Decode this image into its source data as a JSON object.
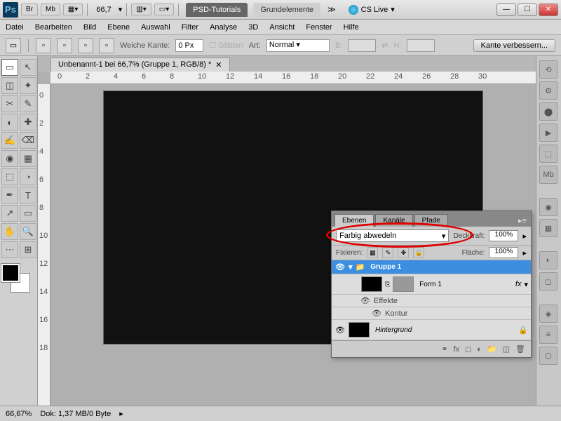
{
  "titlebar": {
    "zoom": "66,7",
    "tab1": "PSD-Tutorials",
    "tab2": "Grundelemente",
    "cslive": "CS Live"
  },
  "menu": [
    "Datei",
    "Bearbeiten",
    "Bild",
    "Ebene",
    "Auswahl",
    "Filter",
    "Analyse",
    "3D",
    "Ansicht",
    "Fenster",
    "Hilfe"
  ],
  "options": {
    "feather_label": "Weiche Kante:",
    "feather_value": "0 Px",
    "antialias": "Glätten",
    "style_label": "Art:",
    "style_value": "Normal",
    "width_label": "B:",
    "height_label": "H:",
    "refine": "Kante verbessern..."
  },
  "document": {
    "tab_title": "Unbenannt-1 bei 66,7% (Gruppe 1, RGB/8) *"
  },
  "ruler_h": [
    "0",
    "2",
    "4",
    "6",
    "8",
    "10",
    "12",
    "14",
    "16",
    "18",
    "20",
    "22",
    "24",
    "26",
    "28",
    "30"
  ],
  "ruler_v": [
    "0",
    "2",
    "4",
    "6",
    "8",
    "10",
    "12",
    "14",
    "16",
    "18"
  ],
  "status": {
    "zoom": "66,67%",
    "doc_info": "Dok: 1,37 MB/0 Byte"
  },
  "layers_panel": {
    "tabs": [
      "Ebenen",
      "Kanäle",
      "Pfade"
    ],
    "blend_mode": "Farbig abwedeln",
    "opacity_label": "Deckkraft:",
    "opacity_value": "100%",
    "fix_label": "Fixieren:",
    "fill_label": "Fläche:",
    "fill_value": "100%",
    "group_name": "Gruppe 1",
    "layer1_name": "Form 1",
    "effects_label": "Effekte",
    "stroke_label": "Kontur",
    "bg_name": "Hintergrund",
    "fx_label": "fx"
  },
  "tools": [
    "▭",
    "↖",
    "◫",
    "✦",
    "✂",
    "✎",
    "◐",
    "✚",
    "✍",
    "⌫",
    "◉",
    "▦",
    "⬚",
    "△",
    "◢",
    "◔",
    "✒",
    "T",
    "↗",
    "▭",
    "✋",
    "🔍",
    "⋯",
    "⊞"
  ]
}
